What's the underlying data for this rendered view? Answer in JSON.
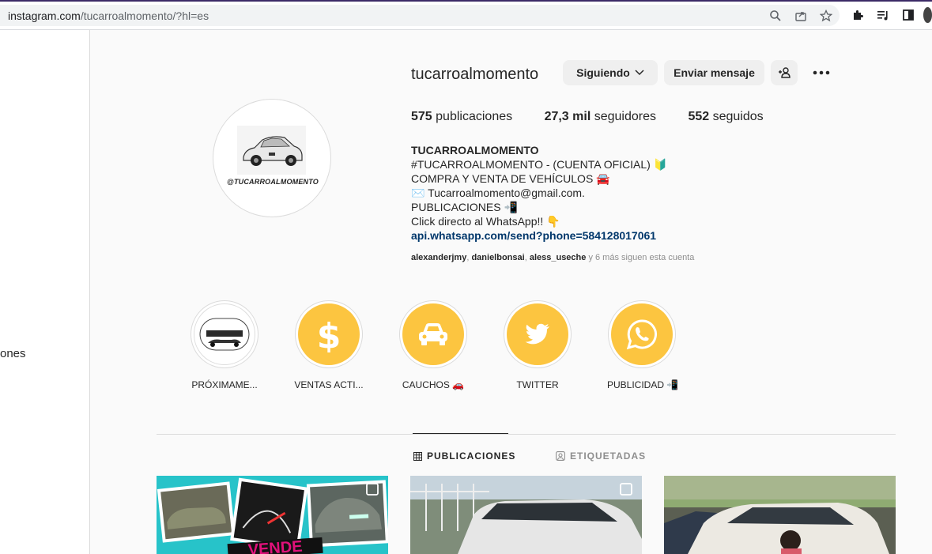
{
  "browser": {
    "url_host": "instagram.com",
    "url_rest": "/tucarroalmomento/?hl=es"
  },
  "leftnav": {
    "partial_label": "ones"
  },
  "profile": {
    "username": "tucarroalmomento",
    "follow_button": "Siguiendo",
    "message_button": "Enviar mensaje",
    "stats": {
      "posts_count": "575",
      "posts_label": "publicaciones",
      "followers_count": "27,3 mil",
      "followers_label": "seguidores",
      "following_count": "552",
      "following_label": "seguidos"
    },
    "avatar_text": "@TUCARROALMOMENTO",
    "bio": {
      "name": "TUCARROALMOMENTO",
      "line1": "#TUCARROALMOMENTO - (CUENTA OFICIAL) 🔰",
      "line2": "COMPRA Y VENTA DE VEHÍCULOS 🚘",
      "line3": "✉️ Tucarroalmomento@gmail.com.",
      "line4": "PUBLICACIONES 📲",
      "line5": "Click directo al WhatsApp!! 👇",
      "link": "api.whatsapp.com/send?phone=584128017061"
    },
    "followed_by": {
      "user1": "alexanderjmy",
      "user2": "danielbonsai",
      "user3": "aless_useche",
      "rest": " y 6 más siguen esta cuenta"
    }
  },
  "highlights": [
    {
      "label": "PRÓXIMAME...",
      "icon": "logo-thumbnail"
    },
    {
      "label": "VENTAS ACTI...",
      "icon": "dollar-icon"
    },
    {
      "label": "CAUCHOS 🚗",
      "icon": "car-icon"
    },
    {
      "label": "TWITTER",
      "icon": "twitter-icon"
    },
    {
      "label": "PUBLICIDAD 📲",
      "icon": "whatsapp-icon"
    }
  ],
  "tabs": {
    "posts": "PUBLICACIONES",
    "tagged": "ETIQUETADAS"
  },
  "colors": {
    "highlight_yellow": "#fcc540",
    "link_blue": "#00376b",
    "post1_bg": "#27c3c9"
  }
}
